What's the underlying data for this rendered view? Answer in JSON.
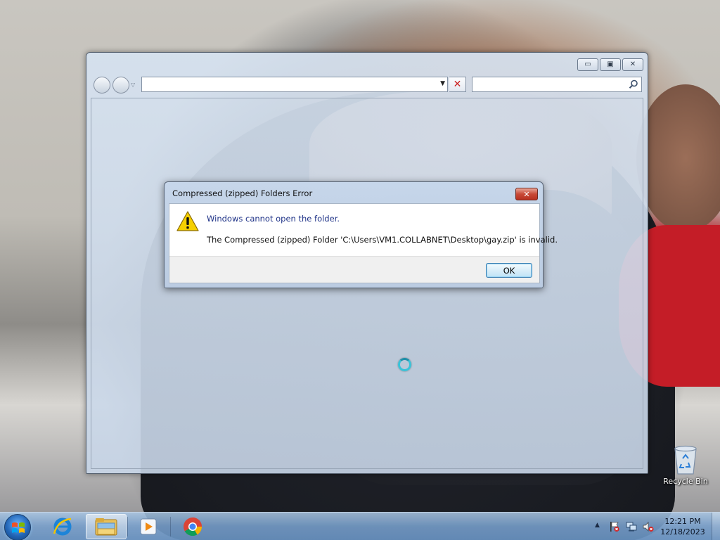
{
  "dialog": {
    "title": "Compressed (zipped) Folders Error",
    "close_glyph": "✕",
    "message": "Windows cannot open the folder.",
    "detail": "The Compressed (zipped) Folder 'C:\\Users\\VM1.COLLABNET\\Desktop\\gay.zip' is invalid.",
    "ok_label": "OK"
  },
  "explorer": {
    "address_value": "",
    "search_value": "",
    "minimize_glyph": "▭",
    "restore_glyph": "▣",
    "close_glyph": "✕",
    "stop_glyph": "✕"
  },
  "desktop": {
    "recycle_bin_label": "Recycle Bin"
  },
  "taskbar": {
    "pinned": [
      {
        "name": "internet-explorer-icon"
      },
      {
        "name": "windows-explorer-icon",
        "active": true
      },
      {
        "name": "media-player-icon"
      },
      {
        "name": "chrome-icon"
      }
    ],
    "clock": {
      "time": "12:21 PM",
      "date": "12/18/2023"
    }
  },
  "colors": {
    "dialog_message": "#1e3287",
    "close_red": "#c84a37",
    "taskbar_blue": "#7aa2cf",
    "busy_cursor": "#39c3d8"
  }
}
